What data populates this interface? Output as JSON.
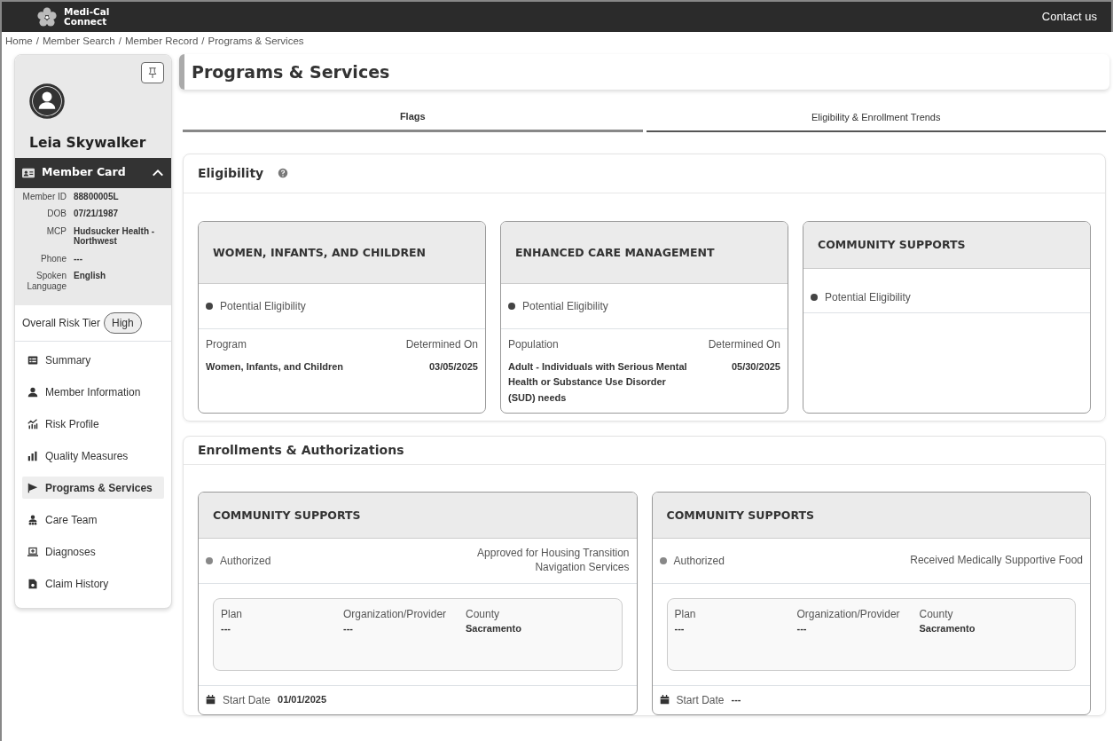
{
  "header": {
    "logo_text": [
      "Medi-Cal",
      "Connect"
    ],
    "contact_link": "Contact us"
  },
  "breadcrumb": [
    {
      "label": "Home"
    },
    {
      "separator": "/",
      "label": "Member Search"
    },
    {
      "separator": "/",
      "label": "Member Record"
    },
    {
      "separator": "/",
      "label": "Programs & Services"
    }
  ],
  "sidebar": {
    "member_name": "Leia Skywalker",
    "member_card": {
      "title": "Member Card",
      "expanded": true,
      "fields": [
        {
          "label": "Member ID",
          "value": "88800005L"
        },
        {
          "label": "DOB",
          "value": "07/21/1987"
        },
        {
          "label": "MCP",
          "value": "Hudsucker Health - Northwest"
        },
        {
          "label": "Phone",
          "value": "---"
        },
        {
          "label": "Spoken Language",
          "value": "English"
        }
      ]
    },
    "risk_tier": {
      "label": "Overall Risk Tier",
      "value": "High"
    },
    "items": [
      {
        "label": "Summary",
        "selected": false
      },
      {
        "label": "Member Information",
        "selected": false
      },
      {
        "label": "Risk Profile",
        "selected": false
      },
      {
        "label": "Quality Measures",
        "selected": false
      },
      {
        "label": "Programs & Services",
        "selected": true
      },
      {
        "label": "Care Team",
        "selected": false
      },
      {
        "label": "Diagnoses",
        "selected": false
      },
      {
        "label": "Claim History",
        "selected": false
      }
    ]
  },
  "page_title": "Programs & Services",
  "tabs": [
    {
      "label": "Flags",
      "selected": true
    },
    {
      "label": "Eligibility & Enrollment Trends",
      "selected": false
    }
  ],
  "eligibility": {
    "title": "Eligibility",
    "cards": [
      {
        "title": "WOMEN, INFANTS, AND CHILDREN",
        "status": "Potential Eligibility",
        "col_1_label": "Program",
        "col_2_label": "Determined On",
        "col_1_value": "Women, Infants, and Children",
        "col_2_value": "03/05/2025"
      },
      {
        "title": "ENHANCED CARE MANAGEMENT",
        "status": "Potential Eligibility",
        "col_1_label": "Population",
        "col_2_label": "Determined On",
        "col_1_value": "Adult - Individuals with Serious Mental Health or Substance Use Disorder (SUD) needs",
        "col_2_value": "05/30/2025"
      },
      {
        "title": "COMMUNITY SUPPORTS",
        "status": "Potential Eligibility"
      }
    ]
  },
  "enrollments": {
    "title": "Enrollments & Authorizations",
    "cards": [
      {
        "title": "COMMUNITY SUPPORTS",
        "status": "Authorized",
        "description": "Approved for Housing Transition Navigation Services",
        "details": [
          {
            "label": "Plan",
            "value": "---"
          },
          {
            "label": "Organization/Provider",
            "value": "---"
          },
          {
            "label": "County",
            "value": "Sacramento"
          }
        ],
        "start_label": "Start Date",
        "start_value": "01/01/2025"
      },
      {
        "title": "COMMUNITY SUPPORTS",
        "status": "Authorized",
        "description": "Received Medically Supportive Food",
        "details": [
          {
            "label": "Plan",
            "value": "---"
          },
          {
            "label": "Organization/Provider",
            "value": "---"
          },
          {
            "label": "County",
            "value": "Sacramento"
          }
        ],
        "start_label": "Start Date",
        "start_value": "---"
      }
    ]
  }
}
